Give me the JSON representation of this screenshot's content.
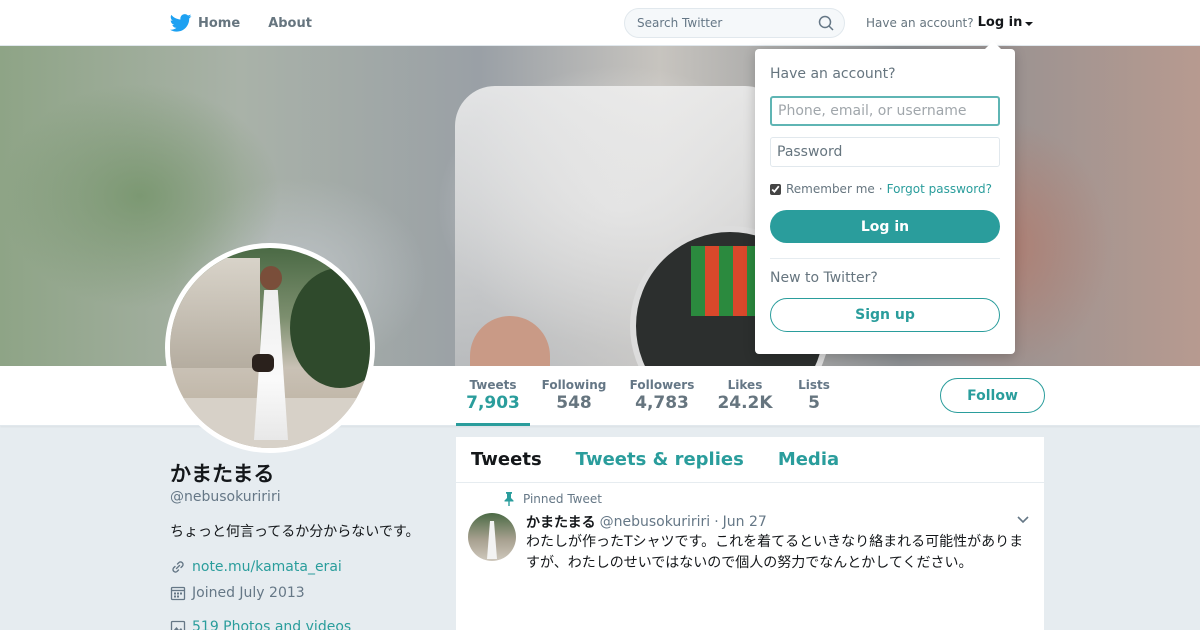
{
  "colors": {
    "accent": "#2a9d9c",
    "text": "#14171a",
    "muted": "#657786",
    "background": "#e6ecf0"
  },
  "topnav": {
    "logo_icon": "twitter-bird-icon",
    "links": [
      {
        "label": "Home"
      },
      {
        "label": "About"
      }
    ],
    "search": {
      "placeholder": "Search Twitter",
      "icon": "search-icon"
    },
    "account_prompt": "Have an account?",
    "login_label": "Log in"
  },
  "login_dropdown": {
    "title": "Have an account?",
    "username_placeholder": "Phone, email, or username",
    "password_placeholder": "Password",
    "remember_label": "Remember me",
    "remember_checked": true,
    "separator": "·",
    "forgot_label": "Forgot password?",
    "login_button": "Log in",
    "new_prompt": "New to Twitter?",
    "signup_button": "Sign up"
  },
  "profile_nav": {
    "stats": [
      {
        "label": "Tweets",
        "value": "7,903",
        "active": true
      },
      {
        "label": "Following",
        "value": "548"
      },
      {
        "label": "Followers",
        "value": "4,783"
      },
      {
        "label": "Likes",
        "value": "24.2K"
      },
      {
        "label": "Lists",
        "value": "5"
      }
    ],
    "follow_button": "Follow"
  },
  "profile": {
    "name": "かまたまる",
    "handle": "@nebusokuririri",
    "bio": "ちょっと何言ってるか分からないです。",
    "link": "note.mu/kamata_erai",
    "joined": "Joined July 2013",
    "photos": "519 Photos and videos"
  },
  "timeline": {
    "tabs": [
      {
        "label": "Tweets",
        "active": true
      },
      {
        "label": "Tweets & replies"
      },
      {
        "label": "Media"
      }
    ],
    "tweet": {
      "pinned_label": "Pinned Tweet",
      "name": "かまたまる",
      "handle": "@nebusokuririri",
      "separator": "·",
      "date": "Jun 27",
      "text_line1": "わたしが作ったTシャツです。これを着てるといきなり絡まれる可能性がありま",
      "text_line2": "すが、わたしのせいではないので個人の努力でなんとかしてください。"
    }
  }
}
